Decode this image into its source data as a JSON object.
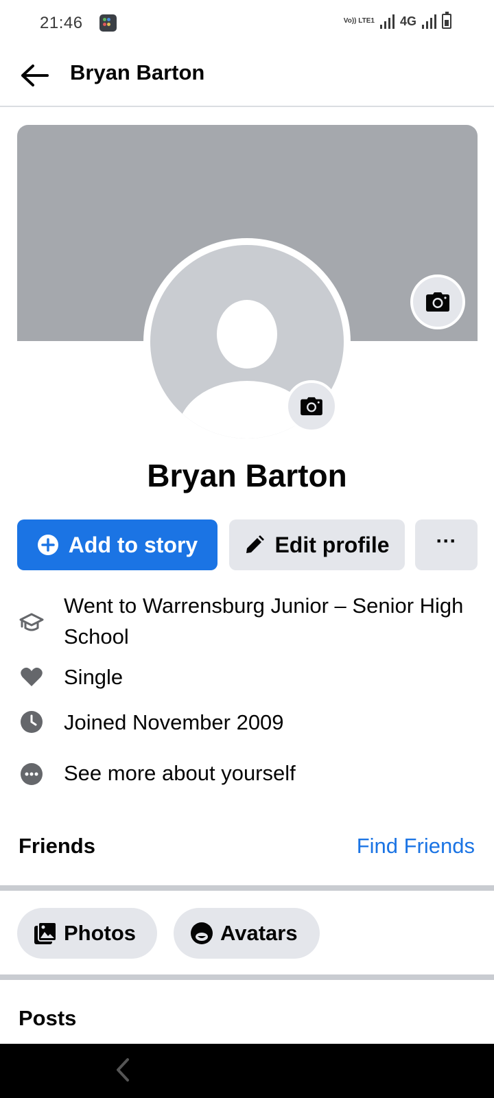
{
  "status_bar": {
    "time": "21:46",
    "volte_label": "Vo)) LTE1",
    "network_label": "4G",
    "icons": [
      "notification-app-icon",
      "volte-icon",
      "signal-icon",
      "signal-icon",
      "battery-icon"
    ]
  },
  "header": {
    "title": "Bryan Barton",
    "back_icon": "arrow-left-icon"
  },
  "profile": {
    "name": "Bryan Barton",
    "cover_color": "#a5a8ad",
    "avatar_color": "#c9ccd1"
  },
  "actions": {
    "add_to_story": "Add to story",
    "edit_profile": "Edit profile",
    "more": "···"
  },
  "details": [
    {
      "icon": "graduation-cap-icon",
      "text": "Went to Warrensburg Junior – Senior High School"
    },
    {
      "icon": "heart-icon",
      "text": "Single"
    },
    {
      "icon": "clock-icon",
      "text": "Joined November 2009"
    },
    {
      "icon": "more-dots-icon",
      "text": "See more about yourself"
    }
  ],
  "friends": {
    "title": "Friends",
    "find_friends": "Find Friends"
  },
  "tabs": {
    "photos": "Photos",
    "avatars": "Avatars"
  },
  "posts": {
    "title": "Posts"
  },
  "colors": {
    "accent": "#1b74e4",
    "button_gray": "#e4e6eb",
    "text": "#050505",
    "icon_gray": "#65676b"
  }
}
